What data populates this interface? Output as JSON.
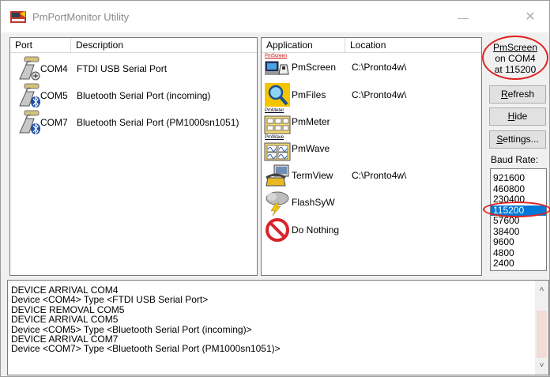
{
  "window": {
    "title": "PmPortMonitor Utility",
    "minimize_glyph": "—",
    "close_glyph": "✕"
  },
  "ports": {
    "headers": {
      "port": "Port",
      "description": "Description"
    },
    "rows": [
      {
        "name": "COM4",
        "description": "FTDI USB Serial Port",
        "icon": "usb-plug-icon"
      },
      {
        "name": "COM5",
        "description": "Bluetooth Serial Port (incoming)",
        "icon": "bluetooth-plug-icon"
      },
      {
        "name": "COM7",
        "description": "Bluetooth Serial Port (PM1000sn1051)",
        "icon": "bluetooth-plug-icon"
      }
    ]
  },
  "apps": {
    "headers": {
      "application": "Application",
      "location": "Location"
    },
    "rows": [
      {
        "name": "PmScreen",
        "location": "C:\\Pronto4w\\",
        "icon": "pmscreen-icon",
        "icon_caption": "PmScreen"
      },
      {
        "name": "PmFiles",
        "location": "C:\\Pronto4w\\",
        "icon": "magnifier-icon"
      },
      {
        "name": "PmMeter",
        "location": "",
        "icon": "pmmeter-icon",
        "icon_caption": "PmMeter"
      },
      {
        "name": "PmWave",
        "location": "",
        "icon": "pmwave-icon",
        "icon_caption": "PmWave"
      },
      {
        "name": "TermView",
        "location": "C:\\Pronto4w\\",
        "icon": "telephone-icon"
      },
      {
        "name": "FlashSyW",
        "location": "",
        "icon": "storm-cloud-icon"
      },
      {
        "name": "Do Nothing",
        "location": "",
        "icon": "no-symbol-icon"
      }
    ]
  },
  "status": {
    "line1": "PmScreen",
    "line2": "on COM4",
    "line3": "at 115200"
  },
  "buttons": {
    "refresh": {
      "accel": "R",
      "rest": "efresh"
    },
    "hide": {
      "accel": "H",
      "rest": "ide"
    },
    "settings": {
      "accel": "S",
      "rest": "ettings..."
    }
  },
  "baud": {
    "label": "Baud Rate:",
    "options": [
      "921600",
      "460800",
      "230400",
      "115200",
      "57600",
      "38400",
      "9600",
      "4800",
      "2400"
    ],
    "selected": "115200"
  },
  "log": {
    "lines": [
      "DEVICE ARRIVAL   COM4",
      "Device <COM4> Type <FTDI USB Serial Port>",
      "DEVICE REMOVAL   COM5",
      "DEVICE ARRIVAL   COM5",
      "Device <COM5> Type <Bluetooth Serial Port (incoming)>",
      "DEVICE ARRIVAL   COM7",
      "Device <COM7> Type <Bluetooth Serial Port (PM1000sn1051)>"
    ],
    "scroll_up_glyph": "˄",
    "scroll_down_glyph": "˅"
  },
  "colors": {
    "highlight": "#e02020",
    "selection": "#0078d7"
  }
}
